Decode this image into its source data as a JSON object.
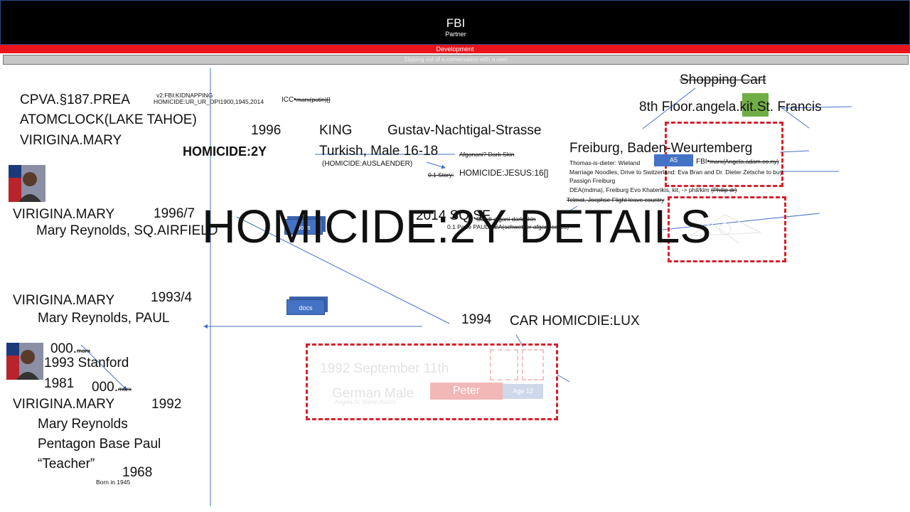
{
  "header": {
    "title": "FBI",
    "subtitle": "Partner",
    "dev_bar": "Development",
    "sub_bar": "Slipping out of a conversation with a user"
  },
  "overlay_title": "HOMICIDE:2Y DETAILS",
  "left": {
    "line1": "CPVA.§187.PREA",
    "line2": "ATOMCLOCK(LAKE TAHOE)",
    "line3": "VIRIGINA.MARY",
    "note_a": "v2:FBI:KIDNAPPING",
    "note_b": "HOMICIDE:UR_UR_OPI1900,1945,2014",
    "icc_label": "ICC",
    "icc_strike": "marx(putin)[]",
    "homicide2y": "HOMICIDE:2Y"
  },
  "row1996": {
    "year": "1996",
    "king": "KING",
    "street": "Gustav-Nachtigal-Strasse",
    "turkish": "Turkish, Male 16-18",
    "afganani": "Afganani? Dark Skin",
    "auslaender": "(HOMICIDE:AUSLAENDER)",
    "story_strike": "0.1 Story:",
    "jesus": "HOMICIDE:JESUS:16[]"
  },
  "freiburg": {
    "title": "Freiburg, Baden-Weurtemberg",
    "l1": "Thomas-is-dieter: Wieland",
    "fbi": "FBI",
    "fbi_strike": "marx(Angela.adam.co.ny)",
    "l2": "Marriage Noodles, Drive to Switzerland: Eva Bran and Dr. Dieter Zetsche to buy",
    "l3": "Passign Freiburg",
    "l4": "DEA(mdma), Freiburg  Evo Khaterikis, kit,  -> phil/kim",
    "l4_strike": "(Philip dr)",
    "l5": "Telmot, Jocphse Flight leave country",
    "a5": "A5"
  },
  "shop": {
    "cart": "Shopping Cart",
    "floor": "8th Floor.angela.kit.St. Francis"
  },
  "mary1": {
    "name": "VIRIGINA.MARY",
    "year": "1996/7",
    "detail": "Mary Reynolds, SQ.AIRFIELD"
  },
  "sq": {
    "title": "2014 SQ.SF",
    "strike1": "Saudi afgani dark skin",
    "line2": "0.1 Pope PAUL",
    "strike2": "DEA(schwetzer afgani cellos)"
  },
  "docs": [
    "docs",
    "docs"
  ],
  "mary2": {
    "name": "VIRIGINA.MARY",
    "year": "1993/4",
    "detail": "Mary Reynolds, PAUL"
  },
  "car": {
    "year": "1994",
    "label": "CAR HOMICDIE:LUX"
  },
  "stanford": {
    "z1": "000.",
    "z1_strike": "marx",
    "l1": "1993 Stanford",
    "l2": "1981",
    "z2": "000.",
    "z2_strike": "marx"
  },
  "mary3": {
    "name": "VIRIGINA.MARY",
    "year": "1992",
    "l1": "Mary Reynolds",
    "l2": "Pentagon Base Paul",
    "l3": "“Teacher”",
    "year2": "1968",
    "born": "Born in 1945"
  },
  "faded_box": {
    "l1": "1992  September 11th",
    "l2": "German Male",
    "l3": "Angela.St. Martin.fiss(0)",
    "peter": "Peter",
    "age": "Age 12"
  }
}
